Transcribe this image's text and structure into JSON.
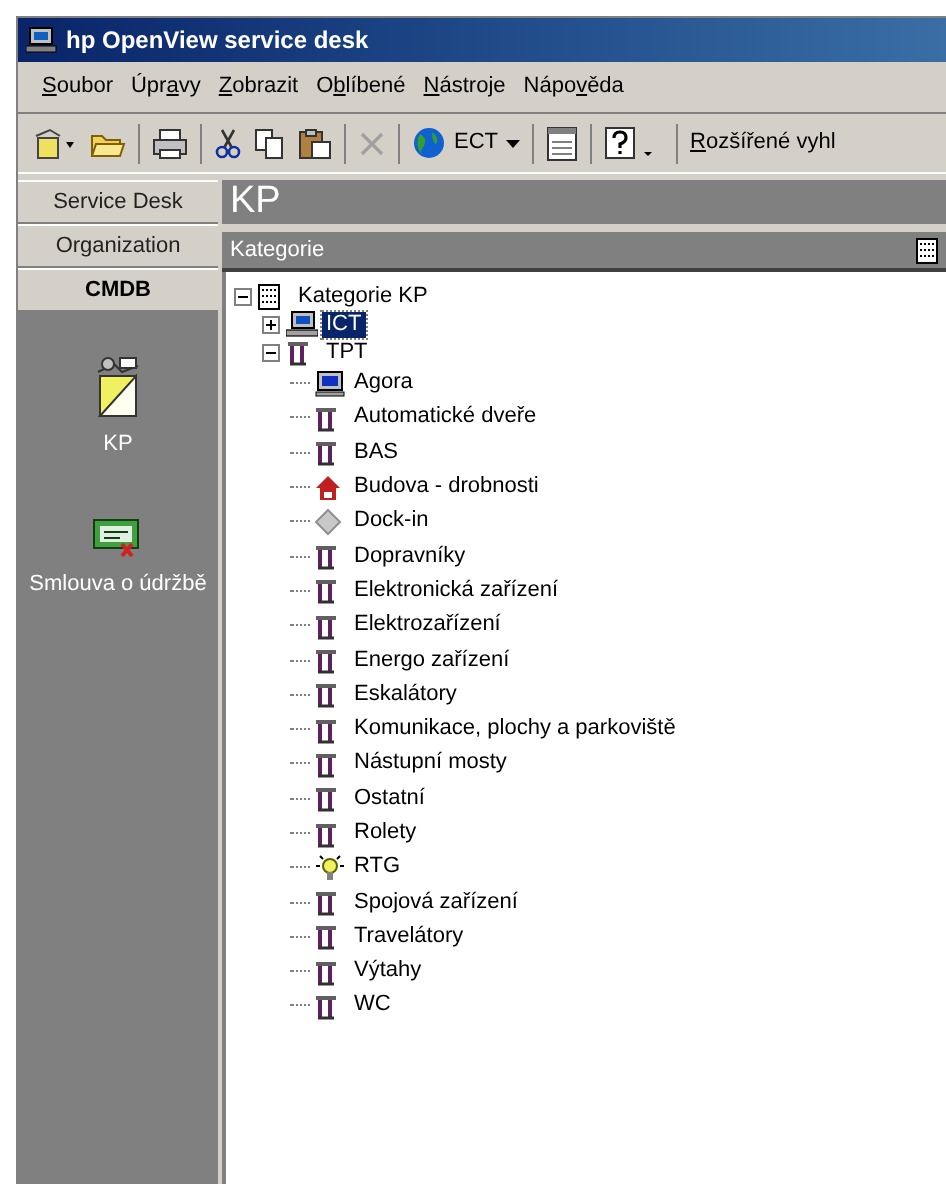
{
  "window": {
    "title": "hp OpenView service desk"
  },
  "menu": [
    {
      "mnemonic": "S",
      "after": "oubor"
    },
    {
      "before": "Úpr",
      "mnemonic": "a",
      "after": "vy"
    },
    {
      "mnemonic": "Z",
      "after": "obrazit"
    },
    {
      "before": "O",
      "mnemonic": "b",
      "after": "líbené"
    },
    {
      "mnemonic": "N",
      "after": "ástroje"
    },
    {
      "before": "Nápo",
      "mnemonic": "v",
      "after": "ěda"
    }
  ],
  "toolbar": {
    "scope": "ECT",
    "advanced_search": {
      "mnemonic": "R",
      "after": "ozšířené vyhl"
    }
  },
  "nav_tabs": [
    {
      "label": "Service Desk",
      "selected": false
    },
    {
      "label": "Organization",
      "selected": false
    },
    {
      "label": "CMDB",
      "selected": true
    }
  ],
  "nav_items": [
    {
      "label": "KP",
      "kind": "box"
    },
    {
      "label": "Smlouva o údržbě",
      "kind": "contract"
    }
  ],
  "panel": {
    "title": "KP",
    "subtitle": "Kategorie"
  },
  "tree": [
    {
      "label": "Kategorie KP",
      "kind": "list",
      "expanded": true,
      "selected": false,
      "children": [
        {
          "label": "ICT",
          "kind": "computer",
          "expanded": false,
          "selected": true
        },
        {
          "label": "TPT",
          "kind": "tool",
          "expanded": true,
          "selected": false,
          "children": [
            {
              "label": "Agora",
              "kind": "monitor"
            },
            {
              "label": "Automatické dveře",
              "kind": "tool"
            },
            {
              "label": "BAS",
              "kind": "tool"
            },
            {
              "label": "Budova - drobnosti",
              "kind": "house"
            },
            {
              "label": "Dock-in",
              "kind": "diamond"
            },
            {
              "label": "Dopravníky",
              "kind": "tool"
            },
            {
              "label": "Elektronická zařízení",
              "kind": "tool"
            },
            {
              "label": "Elektrozařízení",
              "kind": "tool"
            },
            {
              "label": "Energo zařízení",
              "kind": "tool"
            },
            {
              "label": "Eskalátory",
              "kind": "tool"
            },
            {
              "label": "Komunikace, plochy a parkoviště",
              "kind": "tool"
            },
            {
              "label": "Nástupní mosty",
              "kind": "tool"
            },
            {
              "label": "Ostatní",
              "kind": "tool"
            },
            {
              "label": "Rolety",
              "kind": "tool"
            },
            {
              "label": "RTG",
              "kind": "bulb"
            },
            {
              "label": "Spojová zařízení",
              "kind": "tool"
            },
            {
              "label": "Travelátory",
              "kind": "tool"
            },
            {
              "label": "Výtahy",
              "kind": "tool"
            },
            {
              "label": "WC",
              "kind": "tool"
            }
          ]
        }
      ]
    }
  ]
}
